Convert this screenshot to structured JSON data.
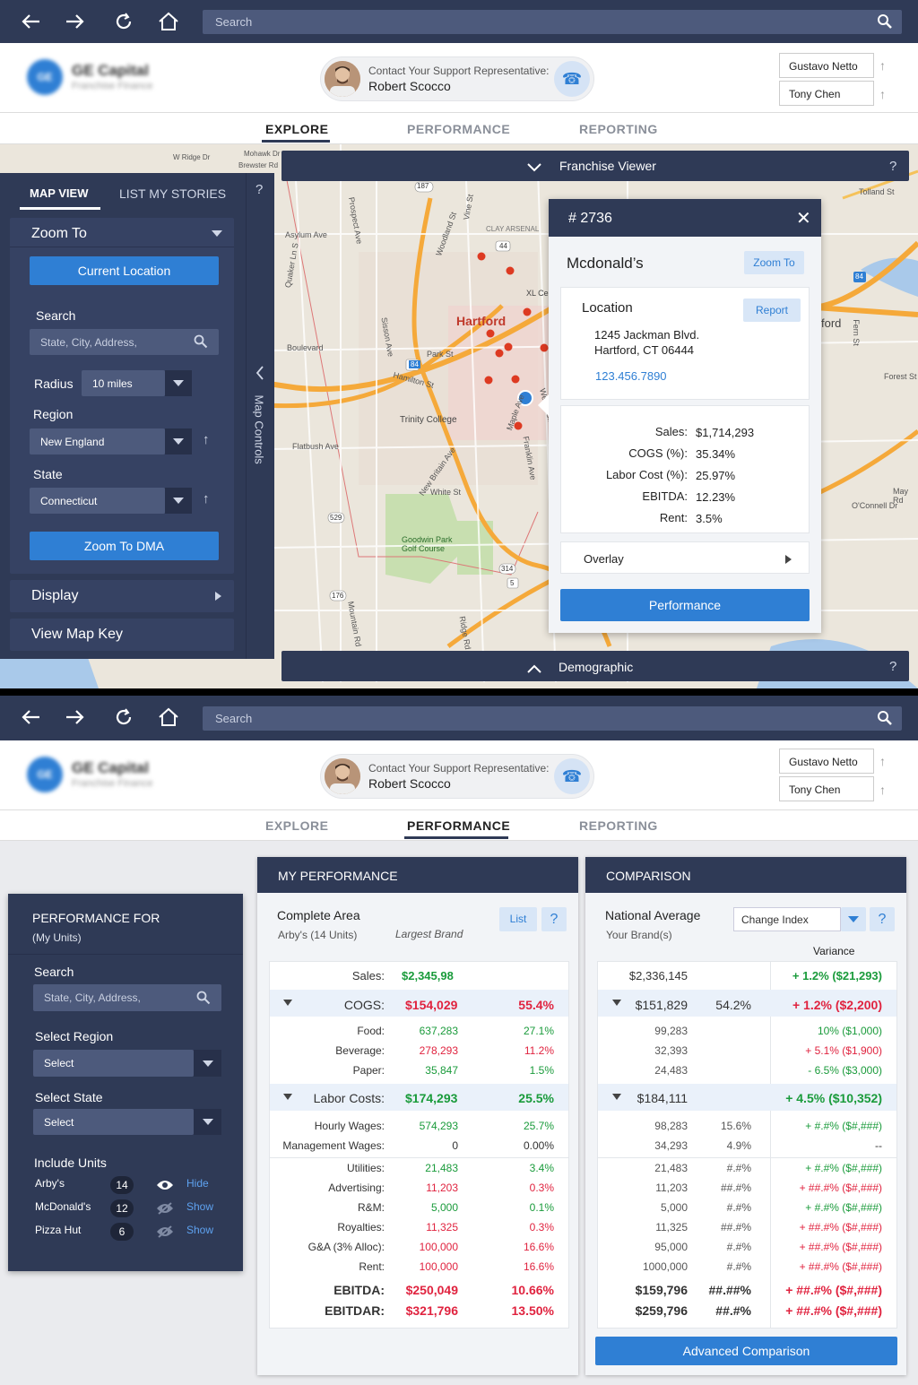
{
  "top": {
    "browser": {
      "search_placeholder": "Search"
    },
    "header": {
      "logo_title": "GE Capital",
      "logo_subtitle": "Franchise Finance",
      "support_label": "Contact Your Support Representative:",
      "support_name": "Robert Scocco",
      "users": [
        "Gustavo Netto",
        "Tony Chen"
      ]
    },
    "tabs": [
      "EXPLORE",
      "PERFORMANCE",
      "REPORTING"
    ],
    "active_tab": "EXPLORE",
    "franchise_viewer": {
      "title": "Franchise Viewer",
      "help": "?"
    },
    "demographic": {
      "title": "Demographic",
      "help": "?"
    },
    "map_controls": {
      "tab_map": "MAP VIEW",
      "tab_list": "LIST MY STORIES",
      "help": "?",
      "zoom_to": "Zoom To",
      "current_location": "Current Location",
      "search_label": "Search",
      "search_placeholder": "State, City, Address,",
      "radius_label": "Radius",
      "radius_value": "10 miles",
      "region_label": "Region",
      "region_value": "New England",
      "state_label": "State",
      "state_value": "Connecticut",
      "zoom_dma": "Zoom To DMA",
      "display": "Display",
      "map_key": "View Map Key",
      "side_label": "Map Controls"
    },
    "map_labels": {
      "hartford": "Hartford",
      "trinity": "Trinity College",
      "goodwin": "Goodwin Park Golf Course",
      "clay": "CLAY ARSENAL",
      "asylum": "Asylum Ave",
      "park": "Park St",
      "boulevard": "Boulevard",
      "whitest": "White St",
      "flatbush": "Flatbush Ave",
      "xlce": "XL Ce",
      "ford": "ford",
      "wridge": "W Ridge Dr",
      "mohawk": "Mohawk Dr",
      "brewster": "Brewster Rd",
      "tolland": "Tolland St",
      "forest": "Forest St",
      "mayrd": "May Rd",
      "oconnell": "O'Connell Dr",
      "fernst": "Fern St",
      "maplea": "Maple Ave",
      "newbritain": "New Britain Ave",
      "prospect": "Prospect Ave",
      "sisson": "Sisson Ave",
      "hamilton": "Hamilton St",
      "vinest": "Vine St",
      "woodland": "Woodland St",
      "franklin": "Franklin Ave",
      "wethersfield": "Wethersfield Ave",
      "quaker": "Quaker Ln S",
      "mountain": "Mountain Rd",
      "ridge": "Ridge Rd",
      "route44": "44",
      "route84": "84",
      "route187": "187",
      "route529": "529",
      "route176": "176",
      "route314": "314",
      "route5": "5",
      "route84b": "84"
    },
    "popup": {
      "id": "# 2736",
      "name": "Mcdonald’s",
      "zoom_to": "Zoom To",
      "location_title": "Location",
      "report": "Report",
      "address1": "1245 Jackman Blvd.",
      "address2": "Hartford, CT 06444",
      "phone": "123.456.7890",
      "stats": [
        {
          "label": "Sales:",
          "value": "$1,714,293"
        },
        {
          "label": "COGS (%):",
          "value": "35.34%"
        },
        {
          "label": "Labor Cost (%):",
          "value": "25.97%"
        },
        {
          "label": "EBITDA:",
          "value": "12.23%"
        },
        {
          "label": "Rent:",
          "value": "3.5%"
        }
      ],
      "overlay": "Overlay",
      "performance": "Performance"
    }
  },
  "bottom": {
    "browser": {
      "search_placeholder": "Search"
    },
    "header": {
      "logo_title": "GE Capital",
      "logo_subtitle": "Franchise Finance",
      "support_label": "Contact Your Support Representative:",
      "support_name": "Robert Scocco",
      "users": [
        "Gustavo Netto",
        "Tony Chen"
      ]
    },
    "tabs": [
      "EXPLORE",
      "PERFORMANCE",
      "REPORTING"
    ],
    "active_tab": "PERFORMANCE",
    "perf_for": {
      "title": "PERFORMANCE FOR",
      "subtitle": "(My Units)",
      "search_label": "Search",
      "search_placeholder": "State, City, Address,",
      "region_label": "Select Region",
      "region_value": "Select",
      "state_label": "Select State",
      "state_value": "Select",
      "units_label": "Include Units",
      "units": [
        {
          "name": "Arby's",
          "count": "14",
          "action": "Hide"
        },
        {
          "name": "McDonald's",
          "count": "12",
          "action": "Show"
        },
        {
          "name": "Pizza Hut",
          "count": "6",
          "action": "Show"
        }
      ]
    },
    "my_perf": {
      "title": "MY PERFORMANCE",
      "area": "Complete Area",
      "area_sub": "Arby's (14 Units)",
      "largest": "Largest Brand",
      "list": "List",
      "help": "?",
      "sales_label": "Sales:",
      "sales_value": "$2,345,98",
      "cogs_label": "COGS:",
      "cogs_value": "$154,029",
      "cogs_pct": "55.4%",
      "cogs_items": [
        {
          "label": "Food:",
          "value": "637,283",
          "pct": "27.1%",
          "c": "g"
        },
        {
          "label": "Beverage:",
          "value": "278,293",
          "pct": "11.2%",
          "c": "r"
        },
        {
          "label": "Paper:",
          "value": "35,847",
          "pct": "1.5%",
          "c": "g"
        }
      ],
      "labor_label": "Labor Costs:",
      "labor_value": "$174,293",
      "labor_pct": "25.5%",
      "labor_items": [
        {
          "label": "Hourly Wages:",
          "value": "574,293",
          "pct": "25.7%",
          "c": "g"
        },
        {
          "label": "Management Wages:",
          "value": "0",
          "pct": "0.00%",
          "c": "d"
        }
      ],
      "other_items": [
        {
          "label": "Utilities:",
          "value": "21,483",
          "pct": "3.4%",
          "c": "g"
        },
        {
          "label": "Advertising:",
          "value": "11,203",
          "pct": "0.3%",
          "c": "r"
        },
        {
          "label": "R&M:",
          "value": "5,000",
          "pct": "0.1%",
          "c": "g"
        },
        {
          "label": "Royalties:",
          "value": "11,325",
          "pct": "0.3%",
          "c": "r"
        },
        {
          "label": "G&A (3% Alloc):",
          "value": "100,000",
          "pct": "16.6%",
          "c": "r"
        },
        {
          "label": "Rent:",
          "value": "100,000",
          "pct": "16.6%",
          "c": "r"
        }
      ],
      "ebitda_label": "EBITDA:",
      "ebitda_value": "$250,049",
      "ebitda_pct": "10.66%",
      "ebitdar_label": "EBITDAR:",
      "ebitdar_value": "$321,796",
      "ebitdar_pct": "13.50%"
    },
    "comparison": {
      "title": "COMPARISON",
      "nat_avg": "National Average",
      "brand": "Your Brand(s)",
      "change_index": "Change Index",
      "help": "?",
      "variance": "Variance",
      "sales": "$2,336,145",
      "sales_var": "+ 1.2% ($21,293)",
      "cogs": "$151,829",
      "cogs_pct": "54.2%",
      "cogs_var": "+ 1.2% ($2,200)",
      "cogs_items": [
        {
          "value": "99,283",
          "pct": "",
          "var": "10% ($1,000)",
          "c": "g"
        },
        {
          "value": "32,393",
          "pct": "",
          "var": "+ 5.1% ($1,900)",
          "c": "r"
        },
        {
          "value": "24,483",
          "pct": "",
          "var": "- 6.5% ($3,000)",
          "c": "g"
        }
      ],
      "labor": "$184,111",
      "labor_var": "+ 4.5% ($10,352)",
      "labor_items": [
        {
          "value": "98,283",
          "pct": "15.6%",
          "var": "+ #.#% ($#,###)",
          "c": "g"
        },
        {
          "value": "34,293",
          "pct": "4.9%",
          "var": "--",
          "c": "d"
        }
      ],
      "other_items": [
        {
          "value": "21,483",
          "pct": "#.#%",
          "var": "+ #.#% ($#,###)",
          "c": "g"
        },
        {
          "value": "11,203",
          "pct": "##.#%",
          "var": "+ ##.#% ($#,###)",
          "c": "r"
        },
        {
          "value": "5,000",
          "pct": "#.#%",
          "var": "+ #.#% ($#,###)",
          "c": "g"
        },
        {
          "value": "11,325",
          "pct": "##.#%",
          "var": "+ ##.#% ($#,###)",
          "c": "r"
        },
        {
          "value": "95,000",
          "pct": "#.#%",
          "var": "+ ##.#% ($#,###)",
          "c": "r"
        },
        {
          "value": "1000,000",
          "pct": "#.#%",
          "var": "+ ##.#% ($#,###)",
          "c": "r"
        }
      ],
      "ebitda": "$159,796",
      "ebitda_pct": "##.##%",
      "ebitda_var": "+ ##.#% ($#,###)",
      "ebitdar": "$259,796",
      "ebitdar_pct": "##.#%",
      "ebitdar_var": "+ ##.#% ($#,###)",
      "advanced": "Advanced Comparison"
    }
  },
  "colors": {
    "navy": "#2f3a56",
    "blue": "#2f7fd4",
    "green": "#1a9b3b",
    "red": "#e0233f"
  }
}
